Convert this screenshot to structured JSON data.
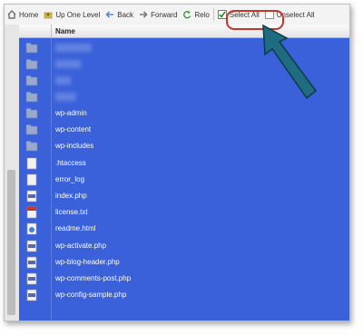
{
  "toolbar": {
    "home": "Home",
    "up": "Up One Level",
    "back": "Back",
    "forward": "Forward",
    "reload": "Relo",
    "select_all": "Select All",
    "unselect_all": "Unselect All"
  },
  "columns": {
    "name": "Name"
  },
  "files": [
    {
      "name": "wp-admin",
      "type": "folder"
    },
    {
      "name": "wp-content",
      "type": "folder"
    },
    {
      "name": "wp-includes",
      "type": "folder"
    },
    {
      "name": ".htaccess",
      "type": "text"
    },
    {
      "name": "error_log",
      "type": "text"
    },
    {
      "name": "index.php",
      "type": "php"
    },
    {
      "name": "license.txt",
      "type": "txt"
    },
    {
      "name": "readme.html",
      "type": "html"
    },
    {
      "name": "wp-activate.php",
      "type": "php"
    },
    {
      "name": "wp-blog-header.php",
      "type": "php"
    },
    {
      "name": "wp-comments-post.php",
      "type": "php"
    },
    {
      "name": "wp-config-sample.php",
      "type": "php"
    }
  ],
  "colors": {
    "selection": "#3a61da",
    "highlight_ring": "#c0392b",
    "pointer_arrow": "#1f6b7f"
  }
}
